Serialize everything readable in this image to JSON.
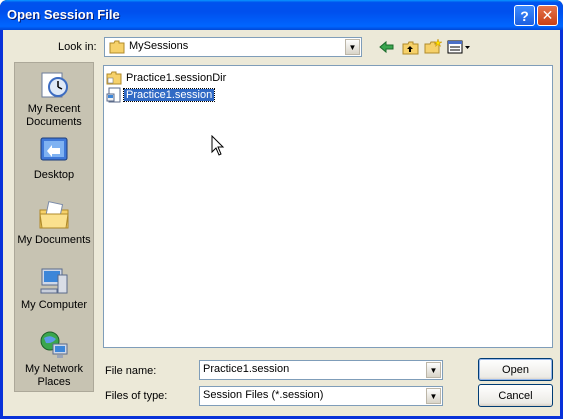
{
  "window": {
    "title": "Open Session File"
  },
  "titlebar_buttons": {
    "help": "?",
    "close": "✕"
  },
  "look_in": {
    "label": "Look in:",
    "value": "MySessions"
  },
  "places": [
    {
      "label": "My Recent Documents",
      "icon": "recent-documents-icon"
    },
    {
      "label": "Desktop",
      "icon": "desktop-icon"
    },
    {
      "label": "My Documents",
      "icon": "my-documents-icon"
    },
    {
      "label": "My Computer",
      "icon": "my-computer-icon"
    },
    {
      "label": "My Network Places",
      "icon": "network-places-icon"
    }
  ],
  "files": [
    {
      "name": "Practice1.sessionDir",
      "icon": "folder-icon",
      "selected": false
    },
    {
      "name": "Practice1.session",
      "icon": "session-file-icon",
      "selected": true
    }
  ],
  "file_name": {
    "label": "File name:",
    "value": "Practice1.session"
  },
  "file_type": {
    "label": "Files of type:",
    "value": "Session Files (*.session)"
  },
  "buttons": {
    "open": "Open",
    "cancel": "Cancel"
  }
}
